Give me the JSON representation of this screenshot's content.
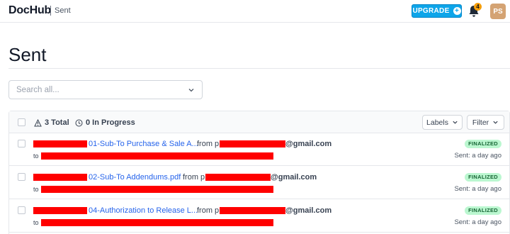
{
  "header": {
    "logo": "DocHub",
    "breadcrumb": "Sent",
    "upgrade_label": "UPGRADE",
    "notification_count": "4",
    "avatar_initials": "PS"
  },
  "page": {
    "title": "Sent"
  },
  "search": {
    "placeholder": "Search all..."
  },
  "table_header": {
    "total_label": "3 Total",
    "in_progress_label": "0 In Progress",
    "labels_button": "Labels",
    "filter_button": "Filter"
  },
  "rows": [
    {
      "doc_name": "01-Sub-To Purchase & Sale A...",
      "from_label": "from p",
      "email_domain": "@gmail.com",
      "to_label": "to",
      "status": "FINALIZED",
      "sent": "Sent: a day ago"
    },
    {
      "doc_name": "02-Sub-To Addendums.pdf",
      "from_label": "from p",
      "email_domain": "@gmail.com",
      "to_label": "to",
      "status": "FINALIZED",
      "sent": "Sent: a day ago"
    },
    {
      "doc_name": "04-Authorization to Release L...",
      "from_label": "from p",
      "email_domain": "@gmail.com",
      "to_label": "to",
      "status": "FINALIZED",
      "sent": "Sent: a day ago"
    }
  ],
  "colors": {
    "accent": "#0ea5e9",
    "link": "#2563eb",
    "finalized_bg": "#bbf7d0",
    "redaction": "#ff0000"
  }
}
